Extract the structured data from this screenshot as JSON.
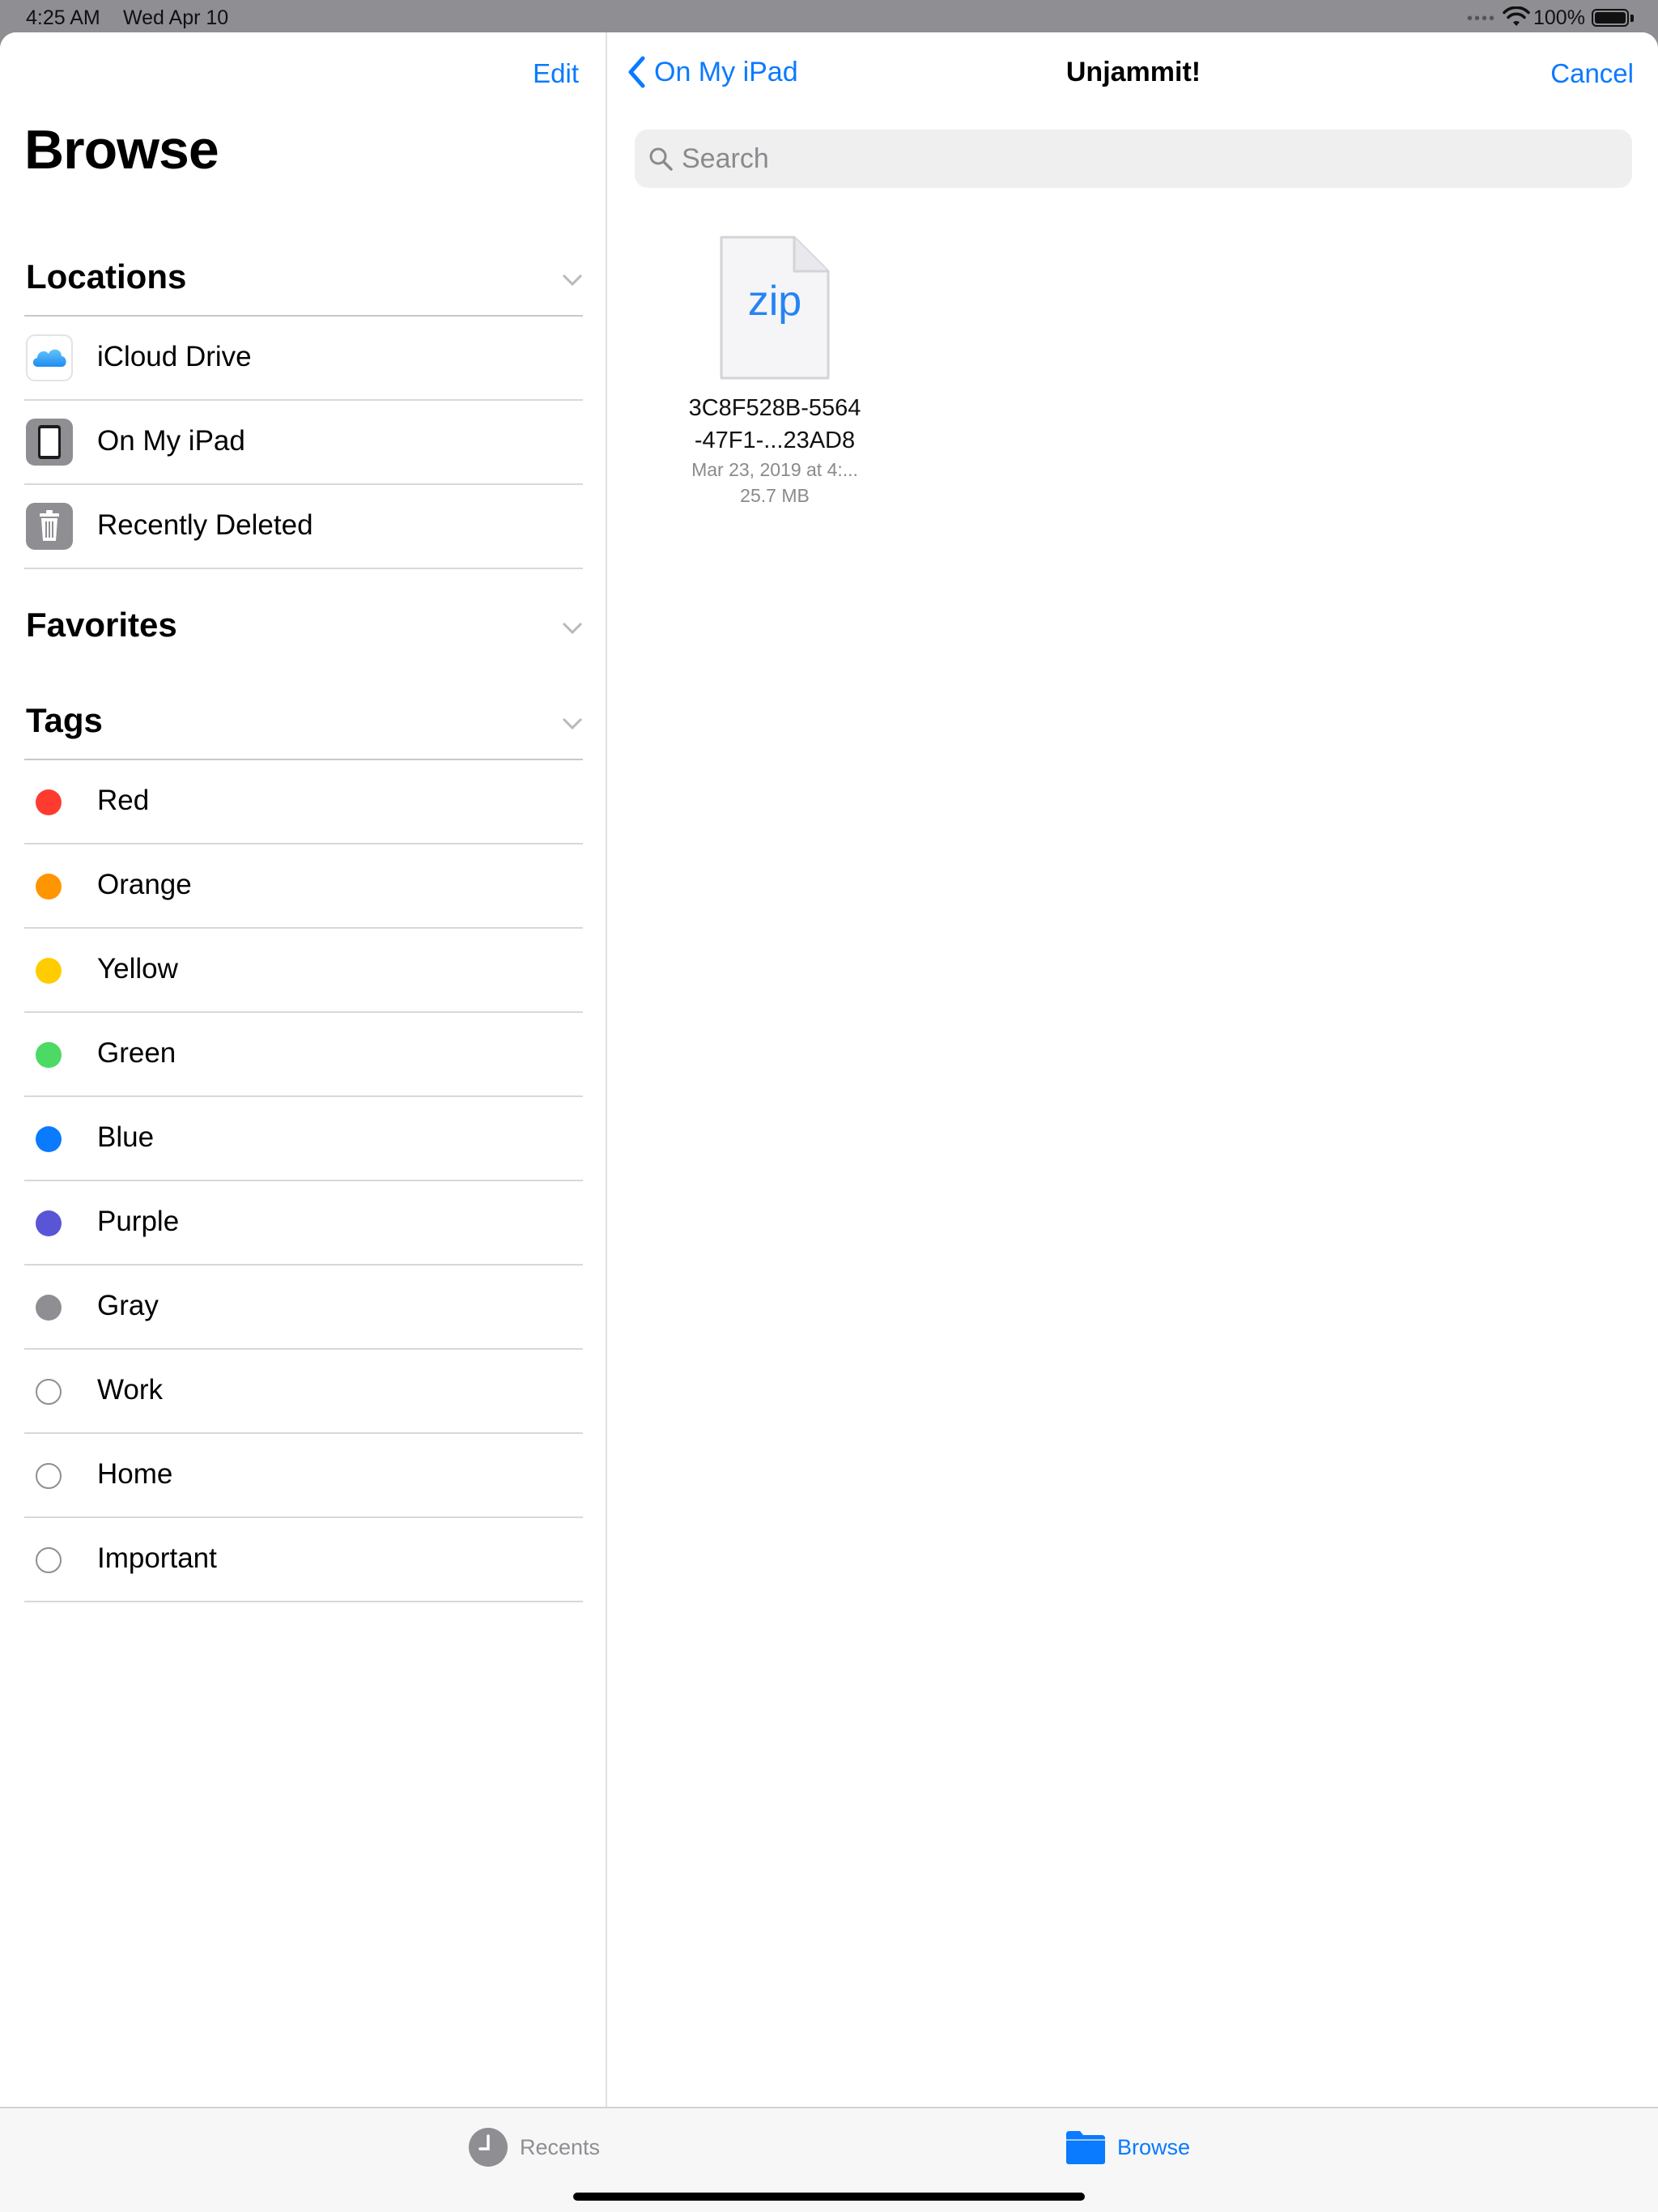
{
  "status_bar": {
    "time": "4:25 AM",
    "date": "Wed Apr 10",
    "battery": "100%"
  },
  "sidebar": {
    "edit_label": "Edit",
    "title": "Browse",
    "locations": {
      "header": "Locations",
      "items": [
        {
          "label": "iCloud Drive",
          "icon": "icloud-icon"
        },
        {
          "label": "On My iPad",
          "icon": "ipad-icon"
        },
        {
          "label": "Recently Deleted",
          "icon": "trash-icon"
        }
      ]
    },
    "favorites": {
      "header": "Favorites"
    },
    "tags": {
      "header": "Tags",
      "items": [
        {
          "label": "Red",
          "color": "#ff3b30"
        },
        {
          "label": "Orange",
          "color": "#ff9500"
        },
        {
          "label": "Yellow",
          "color": "#ffcc00"
        },
        {
          "label": "Green",
          "color": "#4cd964"
        },
        {
          "label": "Blue",
          "color": "#0a7aff"
        },
        {
          "label": "Purple",
          "color": "#5856d6"
        },
        {
          "label": "Gray",
          "color": "#8e8e93"
        },
        {
          "label": "Work",
          "color": "none"
        },
        {
          "label": "Home",
          "color": "none"
        },
        {
          "label": "Important",
          "color": "none"
        }
      ]
    }
  },
  "detail": {
    "back_label": "On My iPad",
    "title": "Unjammit!",
    "cancel_label": "Cancel",
    "search": {
      "placeholder": "Search",
      "value": ""
    },
    "files": [
      {
        "ext": "zip",
        "name_line1": "3C8F528B-5564",
        "name_line2": "-47F1-...23AD8",
        "date": "Mar 23, 2019 at 4:...",
        "size": "25.7 MB"
      }
    ]
  },
  "tab_bar": {
    "recents": "Recents",
    "browse": "Browse"
  },
  "colors": {
    "accent": "#0a7aff"
  }
}
